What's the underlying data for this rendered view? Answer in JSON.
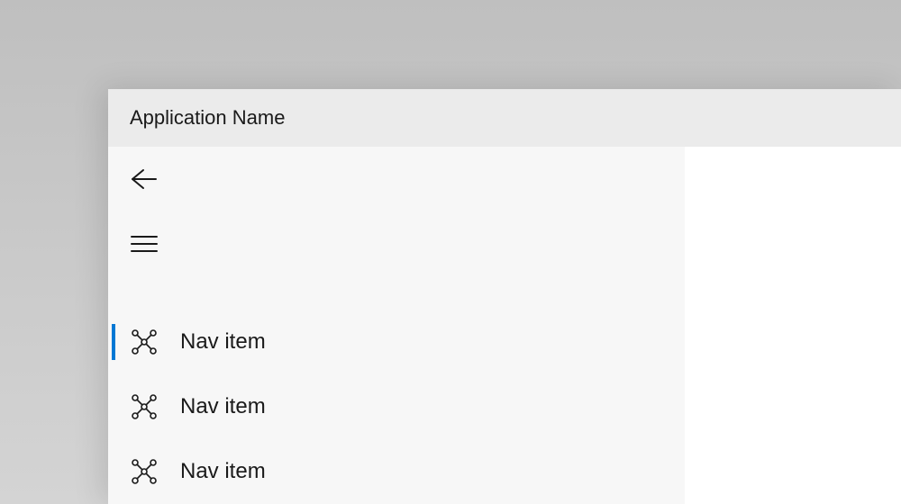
{
  "titlebar": {
    "title": "Application Name"
  },
  "nav": {
    "items": [
      {
        "label": "Nav item",
        "selected": true
      },
      {
        "label": "Nav item",
        "selected": false
      },
      {
        "label": "Nav item",
        "selected": false
      }
    ]
  },
  "colors": {
    "accent": "#0078d4"
  }
}
